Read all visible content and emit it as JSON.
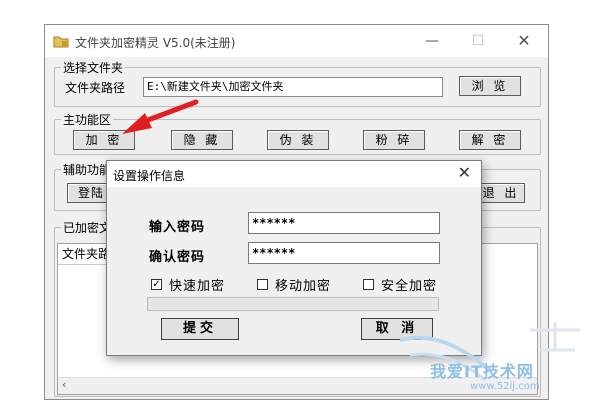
{
  "window": {
    "title": "文件夹加密精灵 V5.0(未注册)",
    "min_glyph": "—",
    "max_glyph": "☐",
    "close_glyph": "✕"
  },
  "select_folder": {
    "legend": "选择文件夹",
    "path_label": "文件夹路径",
    "path_value": "E:\\新建文件夹\\加密文件夹",
    "browse_label": "浏 览"
  },
  "main_functions": {
    "legend": "主功能区",
    "buttons": [
      "加 密",
      "隐 藏",
      "伪 装",
      "粉 碎",
      "解 密"
    ]
  },
  "aux_functions": {
    "legend": "辅助功能",
    "login_partial": "登陆",
    "exit_partial": "退 出"
  },
  "encrypted_list": {
    "legend": "已加密文",
    "column_header": "文件夹路"
  },
  "dialog": {
    "title": "设置操作信息",
    "close_glyph": "✕",
    "password_label": "输入密码",
    "password_value": "******",
    "confirm_label": "确认密码",
    "confirm_value": "******",
    "options": [
      {
        "label": "快速加密",
        "checked": true
      },
      {
        "label": "移动加密",
        "checked": false
      },
      {
        "label": "安全加密",
        "checked": false
      }
    ],
    "submit_label": "提交",
    "cancel_label": "取 消"
  },
  "watermark": {
    "title": "我爱IT技术网",
    "url": "www.52ij.com"
  },
  "colors": {
    "annotation_arrow": "#e02020",
    "watermark": "#8fbfe6"
  }
}
